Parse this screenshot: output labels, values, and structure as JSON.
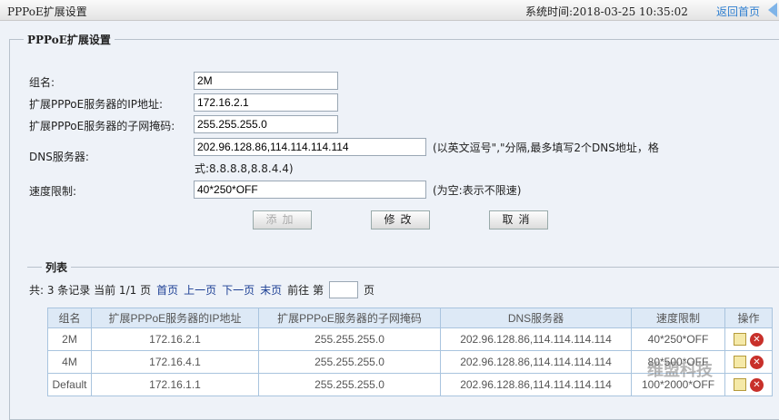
{
  "header": {
    "title": "PPPoE扩展设置",
    "system_time": "系统时间:2018-03-25 10:35:02",
    "home_link": "返回首页"
  },
  "form": {
    "legend": "PPPoE扩展设置",
    "group_label": "组名:",
    "group_value": "2M",
    "ip_label": "扩展PPPoE服务器的IP地址:",
    "ip_value": "172.16.2.1",
    "mask_label": "扩展PPPoE服务器的子网掩码:",
    "mask_value": "255.255.255.0",
    "dns_label": "DNS服务器:",
    "dns_value": "202.96.128.86,114.114.114.114",
    "dns_note_1": "(以英文逗号\",\"分隔,最多填写2个DNS地址，格",
    "dns_note_2": "式:8.8.8.8,8.8.4.4)",
    "speed_label": "速度限制:",
    "speed_value": "40*250*OFF",
    "speed_note": "(为空:表示不限速)",
    "add": "添加",
    "modify": "修改",
    "cancel": "取消"
  },
  "list": {
    "legend": "列表",
    "summary": "共: 3 条记录 当前 1/1 页",
    "first": "首页",
    "prev": "上一页",
    "next": "下一页",
    "last": "末页",
    "goto": "前往 第",
    "page_suffix": "页",
    "columns": [
      "组名",
      "扩展PPPoE服务器的IP地址",
      "扩展PPPoE服务器的子网掩码",
      "DNS服务器",
      "速度限制",
      "操作"
    ],
    "rows": [
      {
        "group": "2M",
        "ip": "172.16.2.1",
        "mask": "255.255.255.0",
        "dns": "202.96.128.86,114.114.114.114",
        "speed": "40*250*OFF"
      },
      {
        "group": "4M",
        "ip": "172.16.4.1",
        "mask": "255.255.255.0",
        "dns": "202.96.128.86,114.114.114.114",
        "speed": "80*500*OFF"
      },
      {
        "group": "Default",
        "ip": "172.16.1.1",
        "mask": "255.255.255.0",
        "dns": "202.96.128.86,114.114.114.114",
        "speed": "100*2000*OFF"
      }
    ]
  },
  "watermark": "维盟科技"
}
